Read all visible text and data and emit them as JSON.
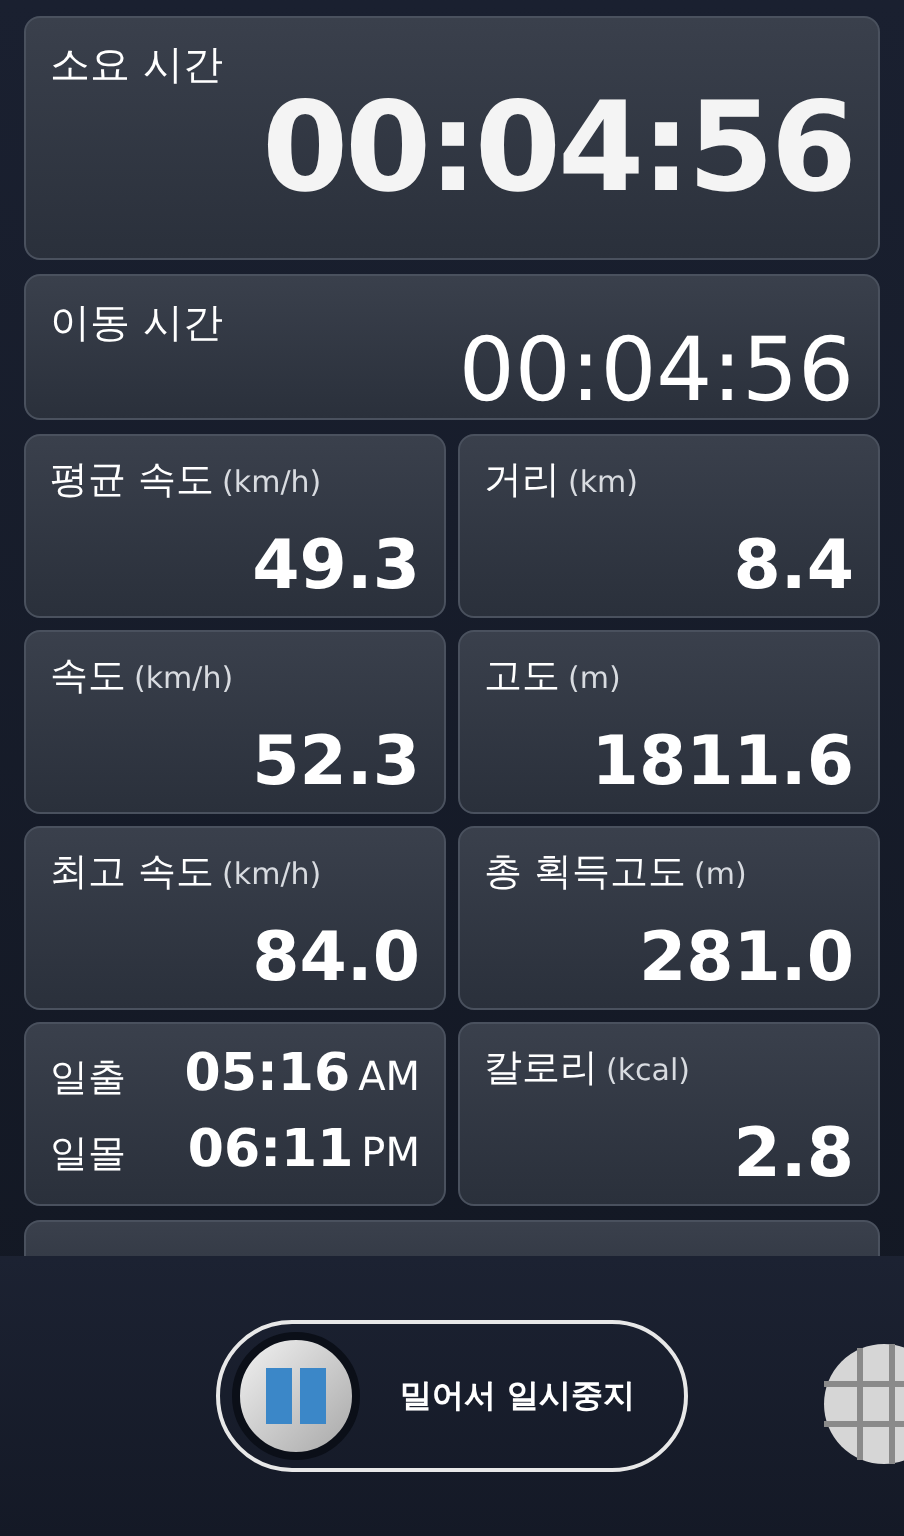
{
  "elapsed": {
    "label": "소요 시간",
    "value": "00:04:56"
  },
  "moving": {
    "label": "이동 시간",
    "value": "00:04:56"
  },
  "stats": [
    {
      "kind": "stat",
      "label": "평균 속도",
      "unit": "(km/h)",
      "value": "49.3"
    },
    {
      "kind": "stat",
      "label": "거리",
      "unit": "(km)",
      "value": "8.4"
    },
    {
      "kind": "stat",
      "label": "속도",
      "unit": "(km/h)",
      "value": "52.3"
    },
    {
      "kind": "stat",
      "label": "고도",
      "unit": "(m)",
      "value": "1811.6"
    },
    {
      "kind": "stat",
      "label": "최고 속도",
      "unit": "(km/h)",
      "value": "84.0"
    },
    {
      "kind": "stat",
      "label": "총 획득고도",
      "unit": "(m)",
      "value": "281.0"
    },
    {
      "kind": "sun",
      "rows": [
        {
          "label": "일출",
          "time": "05:16",
          "ampm": "AM"
        },
        {
          "label": "일몰",
          "time": "06:11",
          "ampm": "PM"
        }
      ]
    },
    {
      "kind": "stat",
      "label": "칼로리",
      "unit": "(kcal)",
      "value": "2.8"
    }
  ],
  "pause_slider": {
    "label": "밀어서 일시중지",
    "level": 0
  }
}
